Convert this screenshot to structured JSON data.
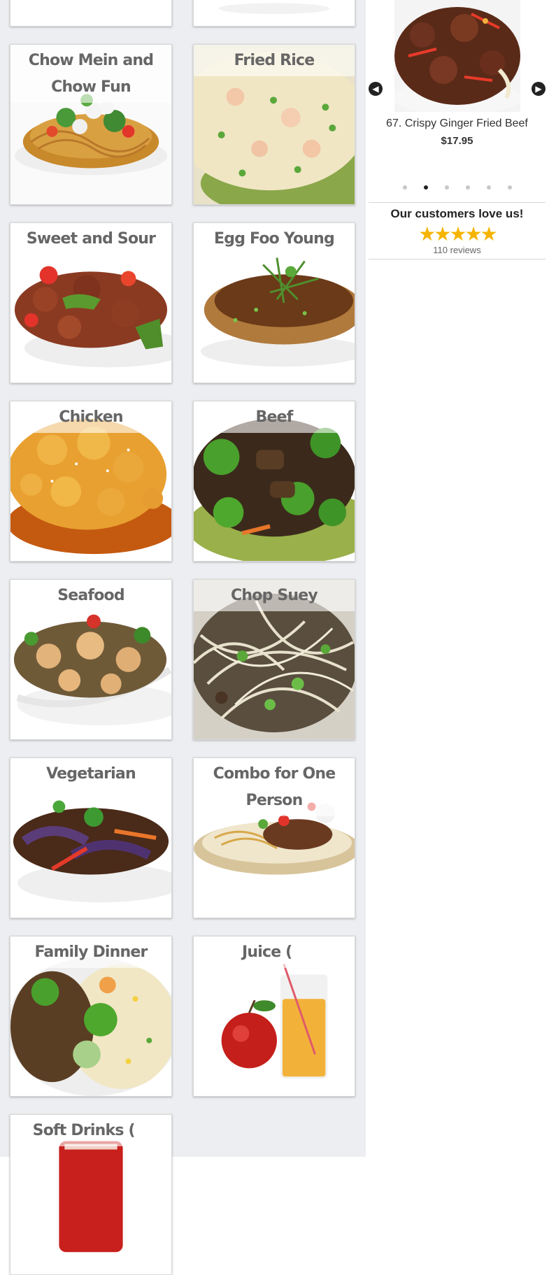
{
  "categories": [
    {
      "label": "",
      "dish": "plate"
    },
    {
      "label": "",
      "dish": "plate"
    },
    {
      "label": "Chow Mein and Chow Fun",
      "dish": "noodles"
    },
    {
      "label": "Fried Rice",
      "dish": "rice"
    },
    {
      "label": "Sweet and Sour",
      "dish": "sweet-sour"
    },
    {
      "label": "Egg Foo Young",
      "dish": "egg-foo-young"
    },
    {
      "label": "Chicken",
      "dish": "chicken"
    },
    {
      "label": "Beef",
      "dish": "beef"
    },
    {
      "label": "Seafood",
      "dish": "shrimp"
    },
    {
      "label": "Chop Suey",
      "dish": "sprouts"
    },
    {
      "label": "Vegetarian",
      "dish": "eggplant"
    },
    {
      "label": "Combo for One Person",
      "dish": "combo"
    },
    {
      "label": "Family Dinner",
      "dish": "family"
    },
    {
      "label": "Juice (   ",
      "dish": "juice"
    },
    {
      "label": "Soft Drinks (   ",
      "dish": "soda"
    }
  ],
  "slider": {
    "item_name": "67. Crispy Ginger Fried Beef",
    "item_price": "$17.95",
    "prev_icon": "chevron-left-icon",
    "next_icon": "chevron-right-icon",
    "dot_count": 6,
    "active_dot": 1
  },
  "reviews": {
    "title": "Our customers love us!",
    "stars": "★★★★★",
    "rating": 5,
    "count": "110 reviews"
  },
  "colors": {
    "left_bg": "#edeef1",
    "title_text": "#666666",
    "star": "#f5b400"
  }
}
